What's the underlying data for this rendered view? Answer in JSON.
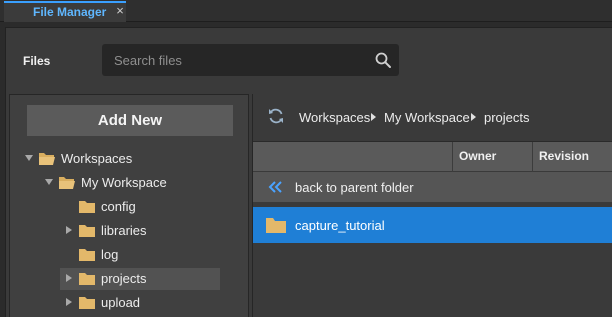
{
  "tab": {
    "title": "File Manager",
    "close": "×"
  },
  "header": {
    "files_label": "Files",
    "search_placeholder": "Search files"
  },
  "left": {
    "add_new_label": "Add New",
    "tree": [
      {
        "label": "Workspaces",
        "caret": "down",
        "open": true
      },
      {
        "label": "My Workspace",
        "caret": "down",
        "open": true
      },
      {
        "label": "config",
        "caret": "none"
      },
      {
        "label": "libraries",
        "caret": "right"
      },
      {
        "label": "log",
        "caret": "none"
      },
      {
        "label": "projects",
        "caret": "right",
        "selected": true
      },
      {
        "label": "upload",
        "caret": "right"
      }
    ]
  },
  "right": {
    "breadcrumb": [
      "Workspaces",
      "My Workspace",
      "projects"
    ],
    "columns": {
      "name": "",
      "owner": "Owner",
      "revision": "Revision"
    },
    "parent_label": "back to parent folder",
    "rows": [
      {
        "name": "capture_tutorial",
        "selected": true
      }
    ]
  },
  "colors": {
    "accent": "#3aa0ff",
    "selection": "#1f7fd6",
    "folder": "#e3b86a"
  }
}
